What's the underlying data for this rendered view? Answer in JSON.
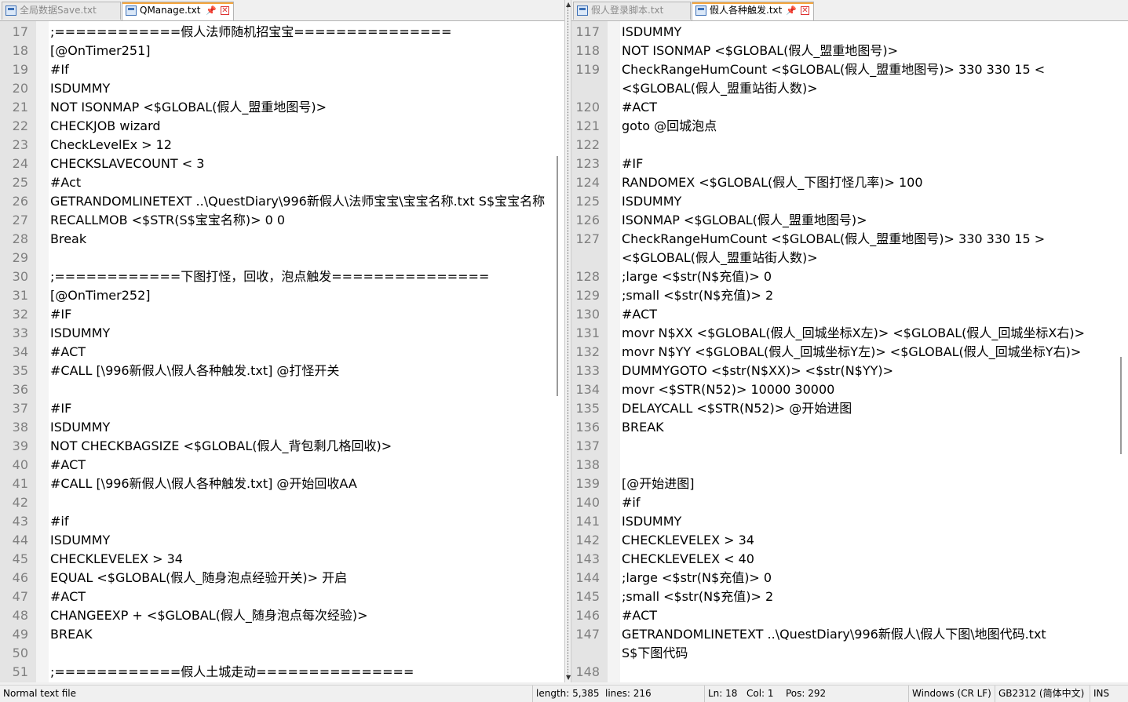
{
  "left_pane": {
    "tabs": [
      {
        "label": "全局数据Save.txt",
        "active": false
      },
      {
        "label": "QManage.txt",
        "active": true,
        "pin": "📌",
        "close": "✕"
      }
    ],
    "lines": [
      {
        "n": "17",
        "t": ";============假人法师随机招宝宝==============="
      },
      {
        "n": "18",
        "t": "[@OnTimer251]"
      },
      {
        "n": "19",
        "t": "#If"
      },
      {
        "n": "20",
        "t": "ISDUMMY"
      },
      {
        "n": "21",
        "t": "NOT ISONMAP <$GLOBAL(假人_盟重地图号)>"
      },
      {
        "n": "22",
        "t": "CHECKJOB wizard"
      },
      {
        "n": "23",
        "t": "CheckLevelEx > 12"
      },
      {
        "n": "24",
        "t": "CHECKSLAVECOUNT < 3"
      },
      {
        "n": "25",
        "t": "#Act"
      },
      {
        "n": "26",
        "t": "GETRANDOMLINETEXT ..\\QuestDiary\\996新假人\\法师宝宝\\宝宝名称.txt S$宝宝名称"
      },
      {
        "n": "27",
        "t": "RECALLMOB <$STR(S$宝宝名称)> 0 0"
      },
      {
        "n": "28",
        "t": "Break"
      },
      {
        "n": "29",
        "t": ""
      },
      {
        "n": "30",
        "t": ";============下图打怪，回收，泡点触发==============="
      },
      {
        "n": "31",
        "t": "[@OnTimer252]"
      },
      {
        "n": "32",
        "t": "#IF"
      },
      {
        "n": "33",
        "t": "ISDUMMY"
      },
      {
        "n": "34",
        "t": "#ACT"
      },
      {
        "n": "35",
        "t": "#CALL [\\996新假人\\假人各种触发.txt] @打怪开关"
      },
      {
        "n": "36",
        "t": ""
      },
      {
        "n": "37",
        "t": "#IF"
      },
      {
        "n": "38",
        "t": "ISDUMMY"
      },
      {
        "n": "39",
        "t": "NOT CHECKBAGSIZE <$GLOBAL(假人_背包剩几格回收)>"
      },
      {
        "n": "40",
        "t": "#ACT"
      },
      {
        "n": "41",
        "t": "#CALL [\\996新假人\\假人各种触发.txt] @开始回收AA"
      },
      {
        "n": "42",
        "t": ""
      },
      {
        "n": "43",
        "t": "#if"
      },
      {
        "n": "44",
        "t": "ISDUMMY"
      },
      {
        "n": "45",
        "t": "CHECKLEVELEX > 34"
      },
      {
        "n": "46",
        "t": "EQUAL <$GLOBAL(假人_随身泡点经验开关)> 开启"
      },
      {
        "n": "47",
        "t": "#ACT"
      },
      {
        "n": "48",
        "t": "CHANGEEXP + <$GLOBAL(假人_随身泡点每次经验)>"
      },
      {
        "n": "49",
        "t": "BREAK"
      },
      {
        "n": "50",
        "t": ""
      },
      {
        "n": "51",
        "t": ";============假人土城走动==============="
      }
    ]
  },
  "right_pane": {
    "tabs": [
      {
        "label": "假人登录脚本.txt",
        "active": false
      },
      {
        "label": "假人各种触发.txt",
        "active": true,
        "pin": "📌",
        "close": "✕"
      }
    ],
    "lines": [
      {
        "n": "117",
        "t": "ISDUMMY"
      },
      {
        "n": "118",
        "t": "NOT ISONMAP <$GLOBAL(假人_盟重地图号)>"
      },
      {
        "n": "119",
        "t": "CheckRangeHumCount <$GLOBAL(假人_盟重地图号)> 330 330 15 <\n<$GLOBAL(假人_盟重站街人数)>",
        "wrap": true
      },
      {
        "n": "120",
        "t": "#ACT"
      },
      {
        "n": "121",
        "t": "goto @回城泡点"
      },
      {
        "n": "122",
        "t": ""
      },
      {
        "n": "123",
        "t": "#IF"
      },
      {
        "n": "124",
        "t": "RANDOMEX <$GLOBAL(假人_下图打怪几率)> 100"
      },
      {
        "n": "125",
        "t": "ISDUMMY"
      },
      {
        "n": "126",
        "t": "ISONMAP <$GLOBAL(假人_盟重地图号)>"
      },
      {
        "n": "127",
        "t": "CheckRangeHumCount <$GLOBAL(假人_盟重地图号)> 330 330 15 >\n<$GLOBAL(假人_盟重站街人数)>",
        "wrap": true
      },
      {
        "n": "128",
        "t": ";large <$str(N$充值)> 0"
      },
      {
        "n": "129",
        "t": ";small <$str(N$充值)> 2"
      },
      {
        "n": "130",
        "t": "#ACT"
      },
      {
        "n": "131",
        "t": "movr N$XX <$GLOBAL(假人_回城坐标X左)> <$GLOBAL(假人_回城坐标X右)>"
      },
      {
        "n": "132",
        "t": "movr N$YY <$GLOBAL(假人_回城坐标Y左)> <$GLOBAL(假人_回城坐标Y右)>"
      },
      {
        "n": "133",
        "t": "DUMMYGOTO <$str(N$XX)> <$str(N$YY)>"
      },
      {
        "n": "134",
        "t": "movr <$STR(N52)> 10000 30000"
      },
      {
        "n": "135",
        "t": "DELAYCALL <$STR(N52)> @开始进图"
      },
      {
        "n": "136",
        "t": "BREAK"
      },
      {
        "n": "137",
        "t": ""
      },
      {
        "n": "138",
        "t": ""
      },
      {
        "n": "139",
        "t": "[@开始进图]"
      },
      {
        "n": "140",
        "t": "#if"
      },
      {
        "n": "141",
        "t": "ISDUMMY"
      },
      {
        "n": "142",
        "t": "CHECKLEVELEX > 34"
      },
      {
        "n": "143",
        "t": "CHECKLEVELEX < 40"
      },
      {
        "n": "144",
        "t": ";large <$str(N$充值)> 0"
      },
      {
        "n": "145",
        "t": ";small <$str(N$充值)> 2"
      },
      {
        "n": "146",
        "t": "#ACT"
      },
      {
        "n": "147",
        "t": "GETRANDOMLINETEXT ..\\QuestDiary\\996新假人\\假人下图\\地图代码.txt\nS$下图代码",
        "wrap": true
      },
      {
        "n": "148",
        "t": ""
      }
    ]
  },
  "status_bar": {
    "mode": "Normal text file",
    "length": "length: 5,385",
    "lines": "lines: 216",
    "ln": "Ln: 18",
    "col": "Col: 1",
    "pos": "Pos: 292",
    "eol": "Windows (CR LF)",
    "encoding": "GB2312 (简体中文)",
    "ins": "INS"
  },
  "colors": {
    "active_tab_accent": "#f5a63d",
    "line_number": "#808080",
    "gutter": "#e4e4e4"
  }
}
